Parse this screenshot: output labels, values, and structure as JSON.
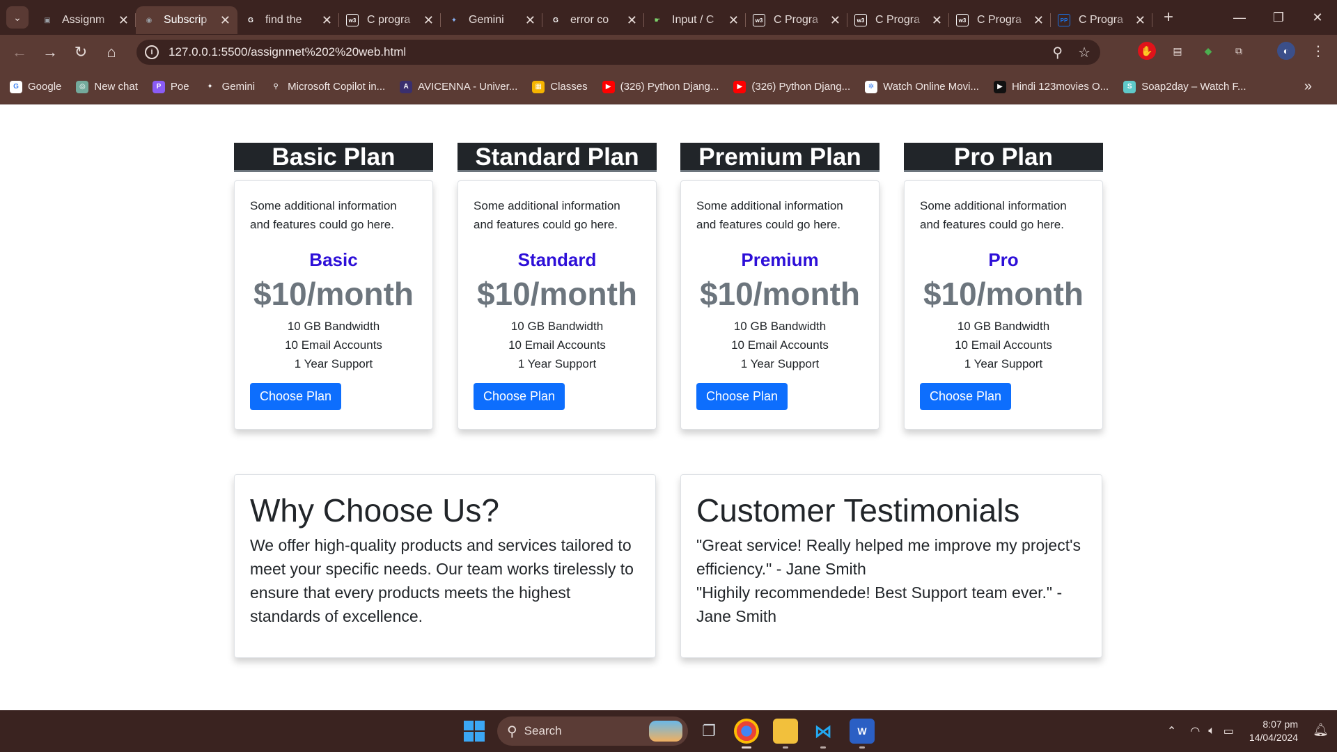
{
  "browser": {
    "tabs": [
      {
        "title": "Assignm",
        "icon": "doc-icon",
        "color": "#9aa0a6",
        "glyph": "▣"
      },
      {
        "title": "Subscrip",
        "icon": "globe-icon",
        "color": "#9aa0a6",
        "glyph": "◉",
        "active": true
      },
      {
        "title": "find the",
        "icon": "google-icon",
        "color": "#ffffff",
        "glyph": "G"
      },
      {
        "title": "C progra",
        "icon": "w3schools-icon",
        "color": "#ffffff",
        "glyph": "w3"
      },
      {
        "title": "Gemini",
        "icon": "gemini-icon",
        "color": "#8ab4f8",
        "glyph": "✦"
      },
      {
        "title": "error co",
        "icon": "google-icon",
        "color": "#ffffff",
        "glyph": "G"
      },
      {
        "title": "Input / C",
        "icon": "programiz-icon",
        "color": "#7cd16b",
        "glyph": "☛"
      },
      {
        "title": "C Progra",
        "icon": "w3schools-icon",
        "color": "#ffffff",
        "glyph": "w3"
      },
      {
        "title": "C Progra",
        "icon": "w3schools-icon",
        "color": "#ffffff",
        "glyph": "w3"
      },
      {
        "title": "C Progra",
        "icon": "w3schools-icon",
        "color": "#ffffff",
        "glyph": "w3"
      },
      {
        "title": "C Progra",
        "icon": "programiz-icon",
        "color": "#1a73e8",
        "glyph": "PP"
      }
    ],
    "url": "127.0.0.1:5500/assignmet%202%20web.html",
    "bookmarks": [
      {
        "label": "Google",
        "icon": "google-icon",
        "color": "#ffffff",
        "glyph": "G"
      },
      {
        "label": "New chat",
        "icon": "chatgpt-icon",
        "color": "#74aa9c",
        "glyph": "◎"
      },
      {
        "label": "Poe",
        "icon": "poe-icon",
        "color": "#8a5cf5",
        "glyph": "P"
      },
      {
        "label": "Gemini",
        "icon": "gemini-icon",
        "color": "#5b3b34",
        "glyph": "✦"
      },
      {
        "label": "Microsoft Copilot in...",
        "icon": "bing-search-icon",
        "color": "#5b3b34",
        "glyph": "⚲"
      },
      {
        "label": "AVICENNA - Univer...",
        "icon": "avicenna-icon",
        "color": "#3a2f6e",
        "glyph": "A"
      },
      {
        "label": "Classes",
        "icon": "classroom-icon",
        "color": "#f5b400",
        "glyph": "▦"
      },
      {
        "label": "(326) Python Djang...",
        "icon": "youtube-icon",
        "color": "#ff0000",
        "glyph": "▶"
      },
      {
        "label": "(326) Python Djang...",
        "icon": "youtube-icon",
        "color": "#ff0000",
        "glyph": "▶"
      },
      {
        "label": "Watch Online Movi...",
        "icon": "film-icon",
        "color": "#ffffff",
        "glyph": "✲"
      },
      {
        "label": "Hindi 123movies O...",
        "icon": "movie-play-icon",
        "color": "#111111",
        "glyph": "▶"
      },
      {
        "label": "Soap2day – Watch F...",
        "icon": "soap2day-icon",
        "color": "#5fc9c9",
        "glyph": "S"
      }
    ]
  },
  "plans": [
    {
      "header": "Basic Plan",
      "info": "Some additional information and features could go here.",
      "name": "Basic",
      "price": "$10/month",
      "features": [
        "10 GB Bandwidth",
        "10 Email Accounts",
        "1 Year Support"
      ],
      "button": "Choose Plan"
    },
    {
      "header": "Standard Plan",
      "info": "Some additional information and features could go here.",
      "name": "Standard",
      "price": "$10/month",
      "features": [
        "10 GB Bandwidth",
        "10 Email Accounts",
        "1 Year Support"
      ],
      "button": "Choose Plan"
    },
    {
      "header": "Premium Plan",
      "info": "Some additional information and features could go here.",
      "name": "Premium",
      "price": "$10/month",
      "features": [
        "10 GB Bandwidth",
        "10 Email Accounts",
        "1 Year Support"
      ],
      "button": "Choose Plan"
    },
    {
      "header": "Pro Plan",
      "info": "Some additional information and features could go here.",
      "name": "Pro",
      "price": "$10/month",
      "features": [
        "10 GB Bandwidth",
        "10 Email Accounts",
        "1 Year Support"
      ],
      "button": "Choose Plan"
    }
  ],
  "why": {
    "title": "Why Choose Us?",
    "text": "We offer high-quality products and services tailored to meet your specific needs. Our team works tirelessly to ensure that every products meets the highest standards of excellence."
  },
  "testimonials": {
    "title": "Customer Testimonials",
    "quotes": [
      "\"Great service! Really helped me improve my project's efficiency.\" - Jane Smith",
      "\"Highily recommendede! Best Support team ever.\" - Jane Smith"
    ]
  },
  "taskbar": {
    "search_label": "Search",
    "time": "8:07 pm",
    "date": "14/04/2024"
  },
  "colors": {
    "plan_name": "#2d0fd8",
    "button": "#0d6efd",
    "plan_header": "#212529"
  }
}
